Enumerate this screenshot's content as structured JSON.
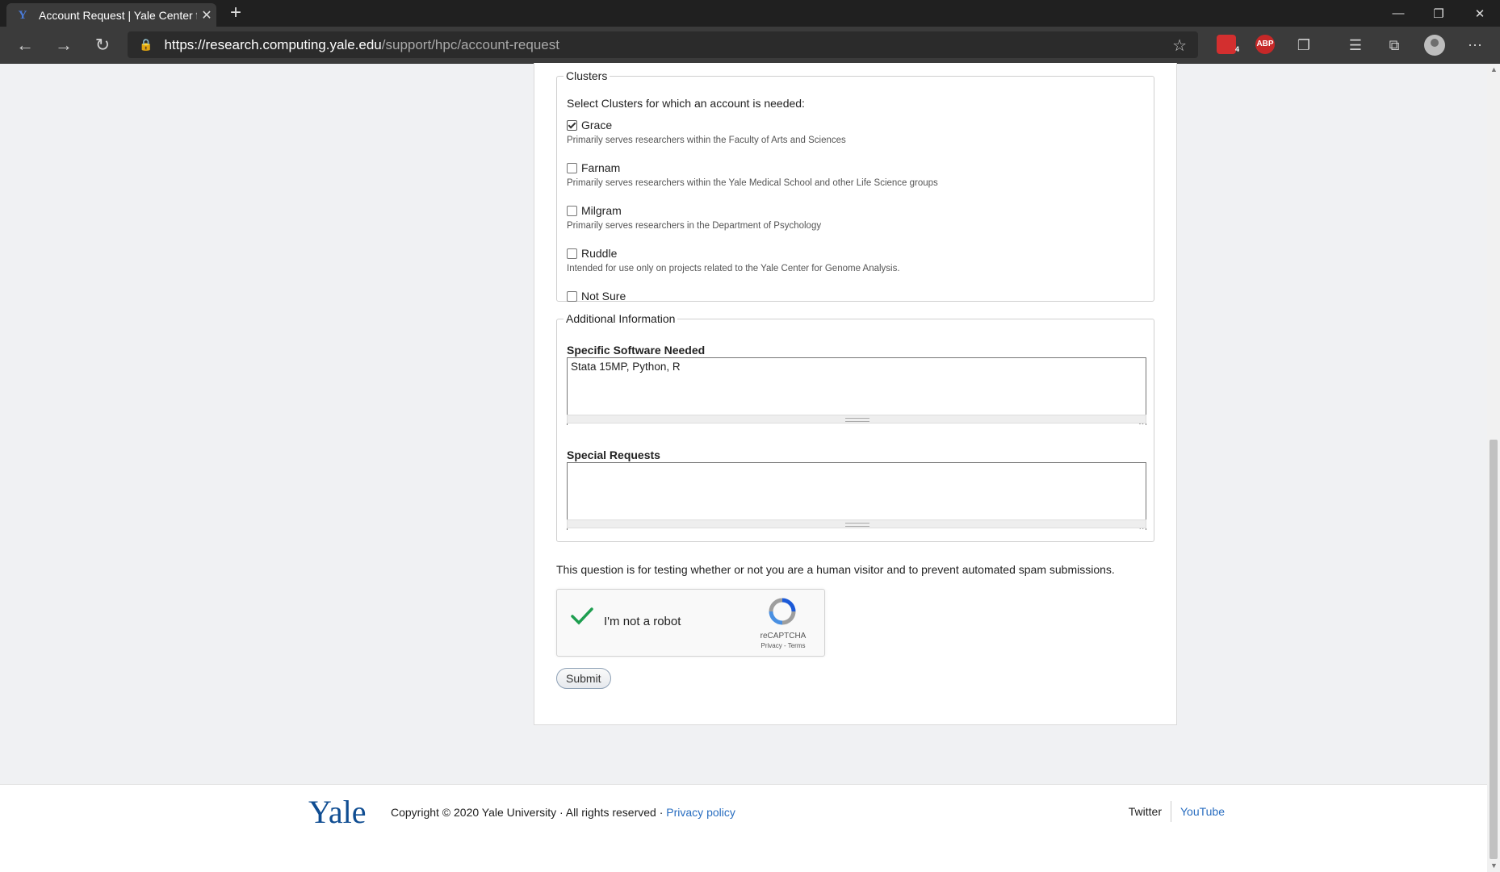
{
  "browser": {
    "tab_title": "Account Request | Yale Center fo",
    "url_host": "https://research.computing.yale.edu",
    "url_path": "/support/hpc/account-request",
    "extension_badge": "4",
    "adblock_label": "ABP"
  },
  "form": {
    "clusters_legend": "Clusters",
    "clusters_help": "Select Clusters for which an account is needed:",
    "clusters": [
      {
        "label": "Grace",
        "checked": true,
        "description": "Primarily serves researchers within the Faculty of Arts and Sciences"
      },
      {
        "label": "Farnam",
        "checked": false,
        "description": "Primarily serves researchers within the Yale Medical School and other Life Science groups"
      },
      {
        "label": "Milgram",
        "checked": false,
        "description": "Primarily serves researchers in the Department of Psychology"
      },
      {
        "label": "Ruddle",
        "checked": false,
        "description": "Intended for use only on projects related to the Yale Center for Genome Analysis."
      },
      {
        "label": "Not Sure",
        "checked": false,
        "description": ""
      }
    ],
    "additional_legend": "Additional Information",
    "software_label": "Specific Software Needed",
    "software_value": "Stata 15MP, Python, R",
    "requests_label": "Special Requests",
    "requests_value": "",
    "spam_note": "This question is for testing whether or not you are a human visitor and to prevent automated spam submissions.",
    "recaptcha": {
      "label": "I'm not a robot",
      "brand": "reCAPTCHA",
      "links": "Privacy - Terms"
    },
    "submit_label": "Submit"
  },
  "footer": {
    "logo_text": "Yale",
    "copyright": "Copyright © 2020 Yale University · All rights reserved · ",
    "privacy_link": "Privacy policy",
    "twitter": "Twitter",
    "youtube": "YouTube"
  }
}
